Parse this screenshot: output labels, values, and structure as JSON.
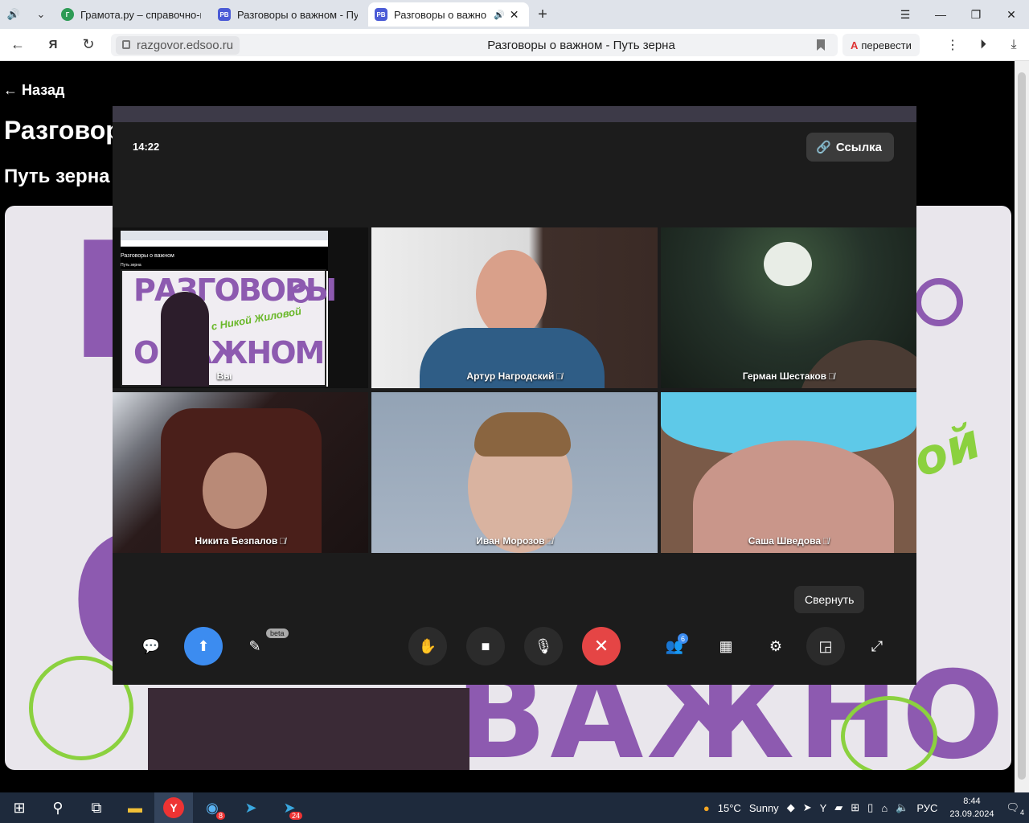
{
  "browser": {
    "tabs": [
      {
        "label": "Грамота.ру – справочно-и",
        "favicon": "Г"
      },
      {
        "label": "Разговоры о важном - Пу",
        "favicon": "РВ"
      },
      {
        "label": "Разговоры о важно",
        "favicon": "РВ"
      }
    ],
    "url": "razgovor.edsoo.ru",
    "page_title": "Разговоры о важном - Путь зерна",
    "translate_label": "перевести"
  },
  "page": {
    "back_label": "← Назад",
    "heading": "Разговор",
    "subheading": "Путь зерна"
  },
  "meeting": {
    "time": "14:22",
    "link_label": "Ссылка",
    "participants": [
      {
        "name": "Вы"
      },
      {
        "name": "Артур Нагродский"
      },
      {
        "name": "Герман Шестаков"
      },
      {
        "name": "Никита Безпалов"
      },
      {
        "name": "Иван Морозов"
      },
      {
        "name": "Саша Шведова"
      }
    ],
    "share_preview": {
      "title": "Разговоры о важном",
      "subtitle": "Путь зерна",
      "line1": "РАЗГОВОРЫ",
      "line2": "О ВАЖНОМ",
      "sign": "с Никой Жиловой"
    },
    "beta_label": "beta",
    "participants_count": "6",
    "tooltip": "Свернуть"
  },
  "taskbar": {
    "weather_temp": "15°C",
    "weather_desc": "Sunny",
    "language": "РУС",
    "time": "8:44",
    "date": "23.09.2024",
    "yandex_badge": "8",
    "telegram_badge": "24",
    "notif_count": "4"
  },
  "colors": {
    "accent_blue": "#3c8cf0",
    "end_call_red": "#e54545",
    "poster_purple": "#8d5ab0",
    "poster_green": "#8bd13f"
  }
}
